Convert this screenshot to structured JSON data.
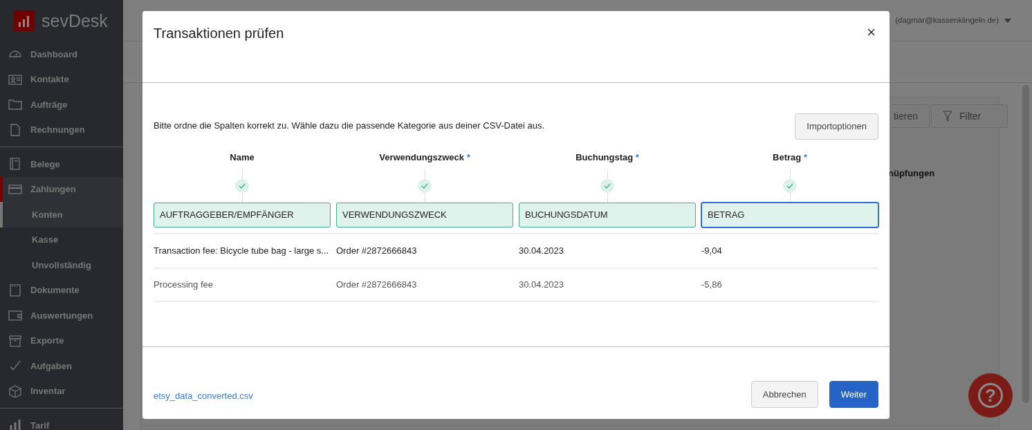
{
  "app": {
    "logo_text": "sevDesk",
    "sidebar": {
      "items": [
        {
          "label": "Dashboard",
          "selected": false
        },
        {
          "label": "Kontakte",
          "selected": false
        },
        {
          "label": "Aufträge",
          "selected": false
        },
        {
          "label": "Rechnungen",
          "selected": false
        },
        {
          "label": "Belege",
          "selected": false,
          "divider_before": true
        },
        {
          "label": "Zahlungen",
          "selected": true,
          "children": [
            {
              "label": "Konten",
              "selected": true
            },
            {
              "label": "Kasse",
              "selected": false
            },
            {
              "label": "Unvollständig",
              "selected": false
            }
          ]
        },
        {
          "label": "Dokumente",
          "selected": false
        },
        {
          "label": "Auswertungen",
          "selected": false
        },
        {
          "label": "Exporte",
          "selected": false
        },
        {
          "label": "Aufgaben",
          "selected": false
        },
        {
          "label": "Inventar",
          "selected": false
        },
        {
          "label": "Tarif",
          "selected": false,
          "divider_before": true
        }
      ]
    },
    "user": "(dagmar@kassenklingeln.de)",
    "toolbar_buttons": [
      "tieren",
      "Filter"
    ],
    "table_header": "nüpfungen",
    "help_button": "?"
  },
  "modal": {
    "title": "Transaktionen prüfen",
    "close": "×",
    "instruction": "Bitte ordne die Spalten korrekt zu. Wähle dazu die passende Kategorie aus deiner CSV-Datei aus.",
    "options_button": "Importoptionen",
    "columns": [
      {
        "header": "Name",
        "required": false,
        "checked": true,
        "mapping": "AUFTRAGGEBER/EMPFÄNGER",
        "focused": false
      },
      {
        "header": "Verwendungszweck",
        "required": true,
        "checked": true,
        "mapping": "VERWENDUNGSZWECK",
        "focused": false
      },
      {
        "header": "Buchungstag",
        "required": true,
        "checked": true,
        "mapping": "BUCHUNGSDATUM",
        "focused": false
      },
      {
        "header": "Betrag",
        "required": true,
        "checked": true,
        "mapping": "BETRAG",
        "focused": true
      }
    ],
    "required_mark": "*",
    "rows": [
      [
        "Transaction fee: Bicycle tube bag - large s...",
        "Order #2872666843",
        "30.04.2023",
        "-9,04"
      ],
      [
        "Processing fee",
        "Order #2872666843",
        "30.04.2023",
        "-5,86"
      ]
    ],
    "file_link": "etsy_data_converted.csv",
    "cancel_button": "Abbrechen",
    "next_button": "Weiter"
  }
}
